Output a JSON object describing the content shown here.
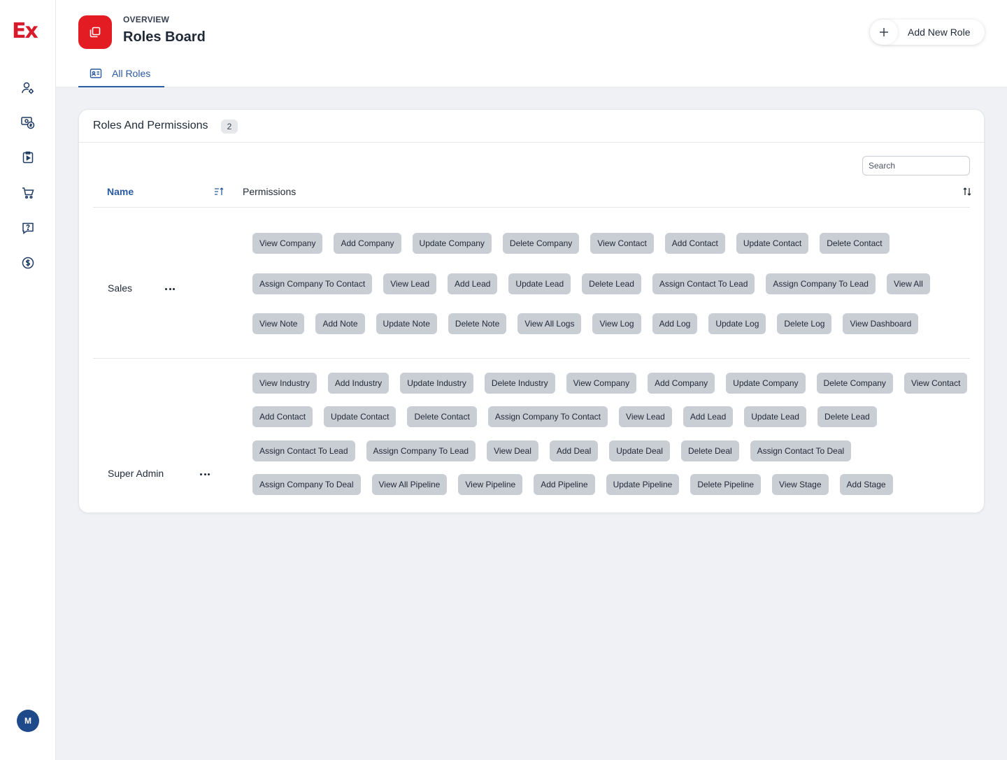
{
  "brand": {
    "logo_text": "Ex"
  },
  "sidebar": {
    "items": [
      {
        "name": "user-settings-icon"
      },
      {
        "name": "payments-icon"
      },
      {
        "name": "clipboard-play-icon"
      },
      {
        "name": "cart-icon"
      },
      {
        "name": "help-chat-icon"
      },
      {
        "name": "dollar-circle-icon"
      }
    ],
    "avatar_initial": "M"
  },
  "header": {
    "overline": "OVERVIEW",
    "title": "Roles Board",
    "add_button_label": "Add New Role",
    "tab_label": "All Roles"
  },
  "card": {
    "title": "Roles And Permissions",
    "count": "2",
    "search_placeholder": "Search",
    "col_name": "Name",
    "col_permissions": "Permissions"
  },
  "roles": [
    {
      "name": "Sales",
      "permissions": [
        "View Company",
        "Add Company",
        "Update Company",
        "Delete Company",
        "View Contact",
        "Add Contact",
        "Update Contact",
        "Delete Contact",
        "Assign Company To Contact",
        "View Lead",
        "Add Lead",
        "Update Lead",
        "Delete Lead",
        "Assign Contact To Lead",
        "Assign Company To Lead",
        "View All",
        "View Note",
        "Add Note",
        "Update Note",
        "Delete Note",
        "View All Logs",
        "View Log",
        "Add Log",
        "Update Log",
        "Delete Log",
        "View Dashboard"
      ]
    },
    {
      "name": "Super Admin",
      "permissions": [
        "View Industry",
        "Add Industry",
        "Update Industry",
        "Delete Industry",
        "View Company",
        "Add Company",
        "Update Company",
        "Delete Company",
        "View Contact",
        "Add Contact",
        "Update Contact",
        "Delete Contact",
        "Assign Company To Contact",
        "View Lead",
        "Add Lead",
        "Update Lead",
        "Delete Lead",
        "Assign Contact To Lead",
        "Assign Company To Lead",
        "View Deal",
        "Add Deal",
        "Update Deal",
        "Delete Deal",
        "Assign Contact To Deal",
        "Assign Company To Deal",
        "View All Pipeline",
        "View Pipeline",
        "Add Pipeline",
        "Update Pipeline",
        "Delete Pipeline",
        "View Stage",
        "Add Stage"
      ]
    }
  ],
  "colors": {
    "brand_red": "#e31b23",
    "accent_blue": "#2a5aa0",
    "chip_bg": "#c9cdd4"
  }
}
